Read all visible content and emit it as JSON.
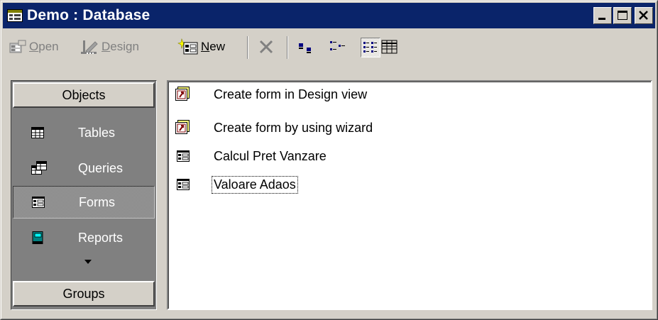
{
  "window": {
    "title": "Demo : Database",
    "icon": "database-window-icon",
    "controls": [
      "minimize-icon",
      "maximize-icon",
      "close-icon"
    ]
  },
  "toolbar": {
    "open": {
      "label": "Open",
      "accelerator": "O",
      "icon": "open-form-icon",
      "enabled": false
    },
    "design": {
      "label": "Design",
      "accelerator": "D",
      "icon": "design-ruler-icon",
      "enabled": false
    },
    "new": {
      "label": "New",
      "accelerator": "N",
      "icon": "new-object-icon",
      "enabled": true
    },
    "delete": {
      "icon": "delete-x-icon",
      "enabled": false
    },
    "views": [
      {
        "name": "large-icons",
        "icon": "large-icons-view-icon",
        "pressed": false
      },
      {
        "name": "small-icons",
        "icon": "small-icons-view-icon",
        "pressed": false
      },
      {
        "name": "list",
        "icon": "list-view-icon",
        "pressed": true
      },
      {
        "name": "details",
        "icon": "details-view-icon",
        "pressed": false
      }
    ]
  },
  "objects_bar": {
    "header": "Objects",
    "items": [
      {
        "label": "Tables",
        "icon": "table-icon",
        "selected": false
      },
      {
        "label": "Queries",
        "icon": "query-icon",
        "selected": false
      },
      {
        "label": "Forms",
        "icon": "form-icon",
        "selected": true
      },
      {
        "label": "Reports",
        "icon": "report-icon",
        "selected": false
      }
    ],
    "groups_header": "Groups"
  },
  "list": {
    "items": [
      {
        "label": "Create form in Design view",
        "icon": "shortcut-wizard-icon",
        "focused": false
      },
      {
        "label": "Create form by using wizard",
        "icon": "shortcut-wizard-icon",
        "focused": false
      },
      {
        "label": "Calcul Pret Vanzare",
        "icon": "form-icon",
        "focused": false
      },
      {
        "label": "Valoare Adaos",
        "icon": "form-icon",
        "focused": true
      }
    ]
  },
  "colors": {
    "titlebar": "#0a246a",
    "face": "#d4d0c8",
    "objects_bar_bg": "#808080",
    "list_bg": "#ffffff"
  }
}
